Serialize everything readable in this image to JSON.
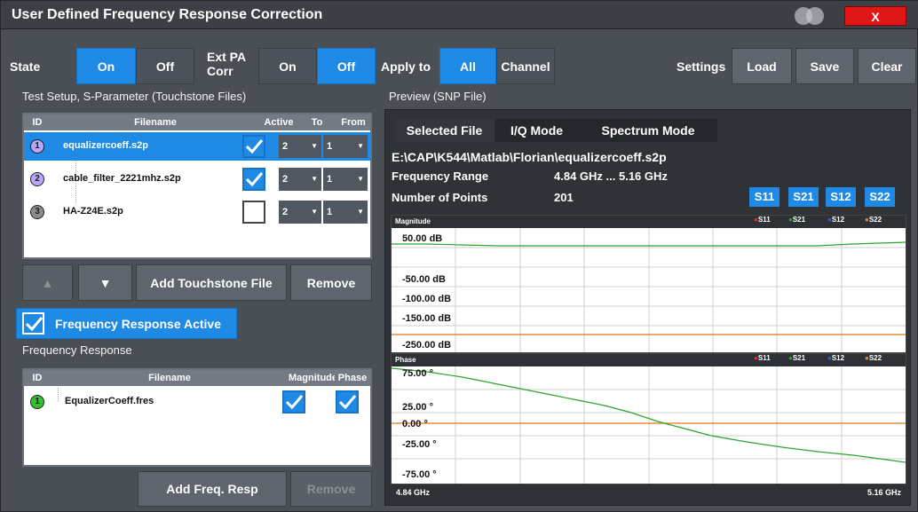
{
  "window": {
    "title": "User Defined Frequency Response Correction",
    "close_label": "X"
  },
  "toolbar": {
    "state_label": "State",
    "state_on": "On",
    "state_off": "Off",
    "extpa_label": "Ext PA Corr",
    "extpa_on": "On",
    "extpa_off": "Off",
    "apply_label": "Apply to",
    "apply_all": "All",
    "apply_channel": "Channel",
    "settings_label": "Settings",
    "load": "Load",
    "save": "Save",
    "clear": "Clear"
  },
  "test_setup": {
    "section_title": "Test Setup, S-Parameter (Touchstone Files)",
    "headers": [
      "ID",
      "Filename",
      "Active",
      "To",
      "From"
    ],
    "rows": [
      {
        "id": "1",
        "filename": "equalizercoeff.s2p",
        "active": true,
        "to": "2",
        "from": "1",
        "color": "#b9a6ff"
      },
      {
        "id": "2",
        "filename": "cable_filter_2221mhz.s2p",
        "active": true,
        "to": "2",
        "from": "1",
        "color": "#b9a6ff"
      },
      {
        "id": "3",
        "filename": "HA-Z24E.s2p",
        "active": false,
        "to": "2",
        "from": "1",
        "color": "#8b8b8b"
      }
    ],
    "up_label": "▲",
    "down_label": "▼",
    "add_label": "Add Touchstone File",
    "remove_label": "Remove"
  },
  "freq_resp_active": {
    "label": "Frequency Response Active",
    "checked": true
  },
  "freq_response": {
    "section_title": "Frequency Response",
    "headers": [
      "ID",
      "Filename",
      "Magnitude",
      "Phase"
    ],
    "rows": [
      {
        "id": "1",
        "filename": "EqualizerCoeff.fres",
        "magnitude": true,
        "phase": true,
        "color": "#2fc32f"
      }
    ],
    "add_label": "Add Freq. Resp",
    "remove_label": "Remove"
  },
  "preview": {
    "section_title": "Preview (SNP File)",
    "tabs": [
      "Selected File",
      "I/Q Mode",
      "Spectrum Mode"
    ],
    "path": "E:\\CAP\\K544\\Matlab\\Florian\\equalizercoeff.s2p",
    "freq_range_label": "Frequency Range",
    "freq_range_value": "4.84 GHz ... 5.16 GHz",
    "points_label": "Number of Points",
    "points_value": "201",
    "sparams": [
      "S11",
      "S21",
      "S12",
      "S22"
    ],
    "legend_colors": [
      "#e03030",
      "#2aa52a",
      "#2f5fe0",
      "#f08a28"
    ],
    "magnitude": {
      "title": "Magnitude",
      "y_ticks": [
        "50.00 dB",
        "-50.00 dB",
        "-100.00 dB",
        "-150.00 dB",
        "-250.00 dB"
      ]
    },
    "phase": {
      "title": "Phase",
      "y_ticks": [
        "75.00 °",
        "25.00 °",
        "0.00 °",
        "-25.00 °",
        "-75.00 °"
      ]
    },
    "x_start": "4.84 GHz",
    "x_stop": "5.16 GHz"
  }
}
